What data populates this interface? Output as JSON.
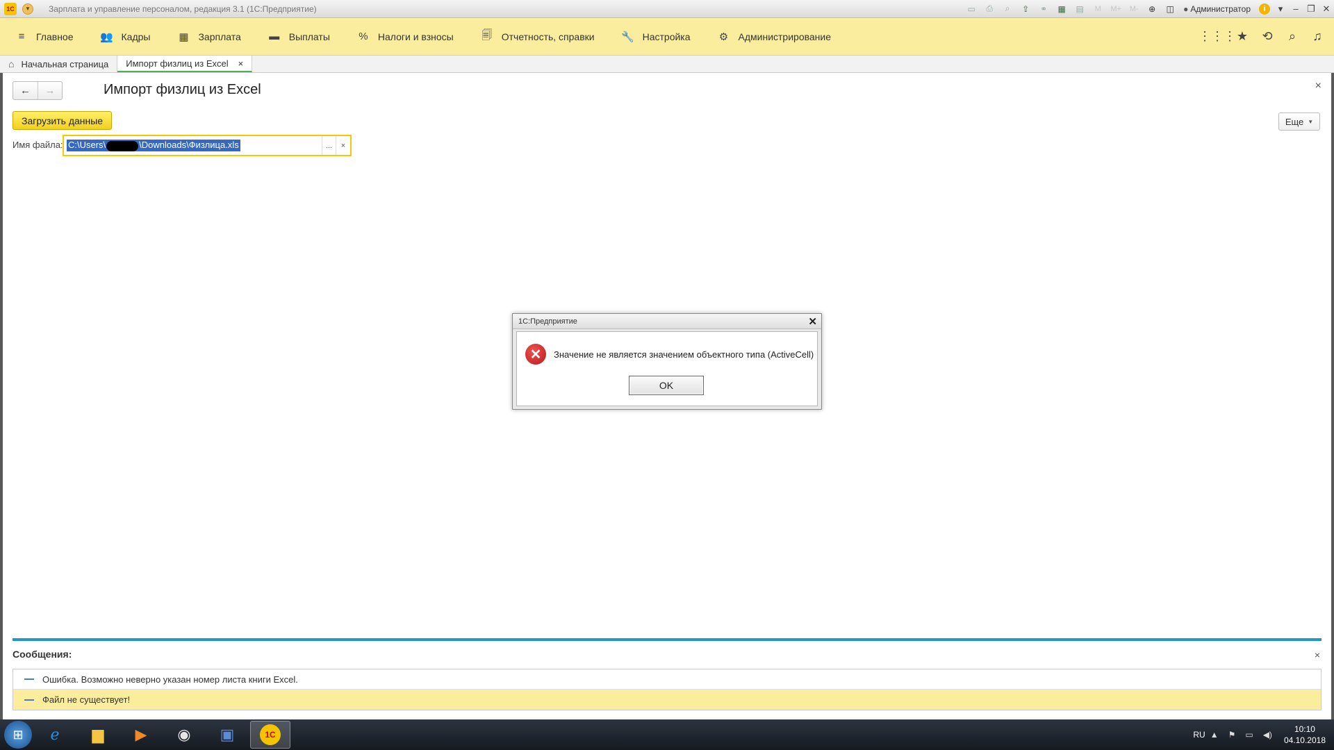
{
  "window": {
    "logo_text": "1С",
    "title": "Зарплата и управление персоналом, редакция 3.1  (1С:Предприятие)",
    "toolbar_text_icons": [
      "M",
      "M+",
      "M-"
    ],
    "user": "Администратор",
    "info_icon": "i"
  },
  "sections": [
    {
      "label": "Главное",
      "icon": "≡",
      "icon_name": "menu-icon"
    },
    {
      "label": "Кадры",
      "icon": "👥",
      "icon_name": "people-icon"
    },
    {
      "label": "Зарплата",
      "icon": "▦",
      "icon_name": "calculator-icon"
    },
    {
      "label": "Выплаты",
      "icon": "▬",
      "icon_name": "wallet-icon"
    },
    {
      "label": "Налоги и взносы",
      "icon": "%",
      "icon_name": "percent-icon"
    },
    {
      "label": "Отчетность, справки",
      "icon": "🗐",
      "icon_name": "reports-icon"
    },
    {
      "label": "Настройка",
      "icon": "🔧",
      "icon_name": "wrench-icon"
    },
    {
      "label": "Администрирование",
      "icon": "⚙",
      "icon_name": "gear-icon"
    }
  ],
  "tabs": {
    "home": "Начальная страница",
    "active": "Импорт физлиц из Excel",
    "close": "×"
  },
  "form": {
    "title": "Импорт физлиц из Excel",
    "close": "×",
    "load_button": "Загрузить данные",
    "more_button": "Еще",
    "file_label": "Имя файла:",
    "file_path_start": "C:\\Users\\",
    "file_path_end": "\\Downloads\\Физлица.xls",
    "select_button": "...",
    "clear_button": "×"
  },
  "dialog": {
    "title": "1С:Предприятие",
    "close": "✕",
    "message": "Значение не является значением объектного типа (ActiveCell)",
    "ok": "OK"
  },
  "messages": {
    "title": "Сообщения:",
    "close": "×",
    "items": [
      {
        "text": "Ошибка. Возможно неверно указан номер листа книги Excel."
      },
      {
        "text": "Файл не существует!"
      }
    ]
  },
  "taskbar": {
    "lang": "RU",
    "time": "10:10",
    "date": "04.10.2018",
    "app_1c": "1С"
  },
  "colors": {
    "section_bar": "#fbed9e",
    "accent_yellow": "#f3d01c",
    "selection_blue": "#3369c5",
    "messages_separator": "#2196c8",
    "error_red": "#c62828"
  }
}
